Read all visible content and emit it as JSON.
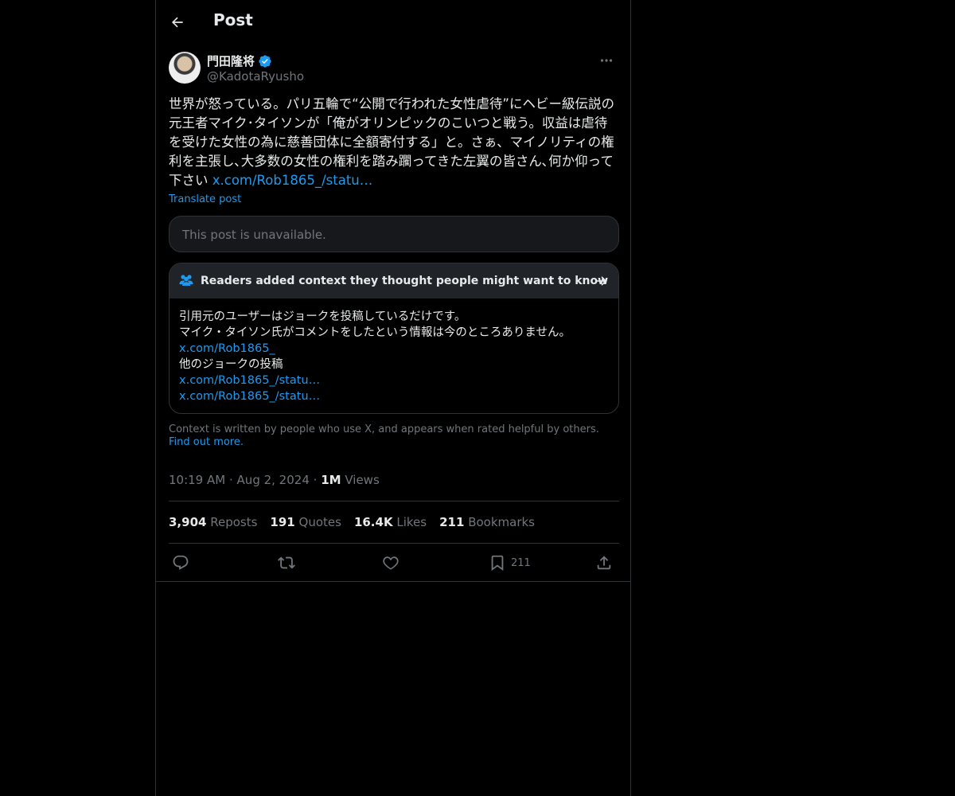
{
  "header": {
    "title": "Post"
  },
  "author": {
    "display_name": "門田隆将",
    "handle": "@KadotaRyusho",
    "verified": true
  },
  "tweet": {
    "text": "世界が怒っている。パリ五輪で“公開で行われた女性虐待”にヘビー級伝説の元王者マイク･タイソンが「俺がオリンピックのこいつと戦う。収益は虐待を受けた女性の為に慈善団体に全額寄付する」と。さぁ、マイノリティの権利を主張し､大多数の女性の権利を踏み躙ってきた左翼の皆さん､何か仰って下さい ",
    "link": "x.com/Rob1865_/statu…",
    "translate_label": "Translate post"
  },
  "quote": {
    "unavailable_text": "This post is unavailable."
  },
  "community_note": {
    "title": "Readers added context they thought people might want to know",
    "line1": "引用元のユーザーはジョークを投稿しているだけです。",
    "line2": "マイク・タイソン氏がコメントをしたという情報は今のところありません。",
    "link1": "x.com/Rob1865_",
    "line3": "他のジョークの投稿",
    "link2": "x.com/Rob1865_/statu…",
    "link3": "x.com/Rob1865_/statu…"
  },
  "context_footer": {
    "text": "Context is written by people who use X, and appears when rated helpful by others.",
    "link": "Find out more."
  },
  "meta": {
    "time": "10:19 AM",
    "date": "Aug 2, 2024",
    "views_count": "1M",
    "views_label": "Views",
    "separator": "·"
  },
  "stats": {
    "reposts_count": "3,904",
    "reposts_label": "Reposts",
    "quotes_count": "191",
    "quotes_label": "Quotes",
    "likes_count": "16.4K",
    "likes_label": "Likes",
    "bookmarks_count": "211",
    "bookmarks_label": "Bookmarks"
  },
  "actions": {
    "bookmark_count": "211"
  },
  "icons": {
    "back": "arrow-left-icon",
    "verified": "verified-badge-icon",
    "more": "more-horizontal-icon",
    "note_people": "people-icon",
    "note_arrow": "arrow-right-icon",
    "reply": "reply-icon",
    "repost": "repost-icon",
    "like": "heart-icon",
    "bookmark": "bookmark-icon",
    "share": "share-icon"
  },
  "colors": {
    "background": "#000000",
    "accent": "#1d9bf0",
    "text_primary": "#e7e9ea",
    "text_secondary": "#71767b",
    "border": "#2f3336"
  }
}
